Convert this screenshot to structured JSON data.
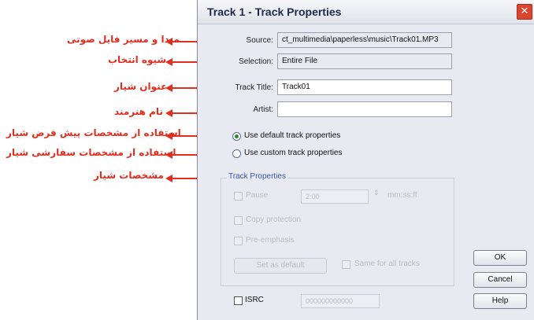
{
  "annotations": [
    "مبدا و مسیر فایل صوتی",
    "شیوه انتخاب",
    "عنوان شیار",
    "نام هنرمند",
    "استفاده از مشخصات پیش فرض شیار",
    "استفاده از مشخصات سفارشی شیار",
    "مشخصات شیار"
  ],
  "dialog": {
    "title": "Track 1 - Track Properties",
    "close": "✕",
    "source": {
      "label": "Source:",
      "value": "ct_multimedia\\paperless\\music\\Track01.MP3"
    },
    "selection": {
      "label": "Selection:",
      "value": "Entire File"
    },
    "track_title": {
      "label": "Track Title:",
      "value": "Track01"
    },
    "artist": {
      "label": "Artist:",
      "value": ""
    },
    "radio_default": {
      "label": "Use default track properties",
      "selected": true
    },
    "radio_custom": {
      "label": "Use custom track properties",
      "selected": false
    },
    "group": {
      "title": "Track Properties",
      "pause_label": "Pause",
      "pause_value": "2:00",
      "pause_unit": "mm:ss:ff",
      "copy_protection": "Copy protection",
      "pre_emphasis": "Pre-emphasis",
      "set_default": "Set as default",
      "same_all": "Same for all tracks"
    },
    "isrc_label": "ISRC",
    "isrc_value": "000000000000",
    "buttons": {
      "ok": "OK",
      "cancel": "Cancel",
      "help": "Help"
    }
  }
}
